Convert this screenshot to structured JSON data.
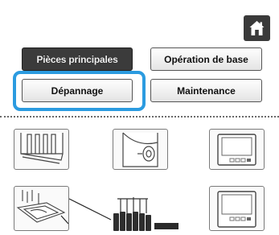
{
  "tabs": {
    "pieces_principales": "Pièces principales",
    "operation_de_base": "Opération de base",
    "depannage": "Dépannage",
    "maintenance": "Maintenance"
  },
  "icons": {
    "home": "home-icon",
    "machine_head": "needle-bar-case-icon",
    "machine_side": "machine-side-knob-icon",
    "lcd_panel": "lcd-panel-icon",
    "embroidery_frame": "embroidery-frame-icon",
    "thread_stand": "thread-spool-stand-icon",
    "lcd_panel_2": "lcd-panel-icon"
  },
  "colors": {
    "highlight": "#2b9be0",
    "dark_tab": "#3b3b3b",
    "home_button": "#3a3a3a"
  }
}
